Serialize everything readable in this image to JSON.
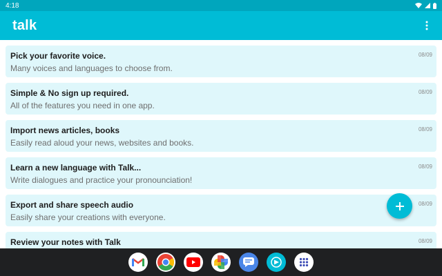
{
  "status_bar": {
    "time": "4:18"
  },
  "app_bar": {
    "title": "talk"
  },
  "notes": [
    {
      "title": "Pick your favorite voice.",
      "subtitle": "Many voices and languages to choose from.",
      "date": "08/09"
    },
    {
      "title": "Simple & No sign up required.",
      "subtitle": "All of the features you need in one app.",
      "date": "08/09"
    },
    {
      "title": "Import news articles, books",
      "subtitle": "Easily read aloud your news, websites and books.",
      "date": "08/09"
    },
    {
      "title": "Learn a new language with Talk...",
      "subtitle": "Write dialogues and practice your pronounciation!",
      "date": "08/09"
    },
    {
      "title": "Export and share speech audio",
      "subtitle": "Easily share your creations with everyone.",
      "date": "08/09"
    },
    {
      "title": "Review your notes with Talk",
      "subtitle": "",
      "date": "08/09"
    }
  ],
  "fab": {
    "icon": "plus-icon"
  },
  "taskbar": {
    "apps": [
      "gmail-icon",
      "chrome-icon",
      "youtube-icon",
      "photos-icon",
      "messages-icon",
      "talk-app-icon",
      "app-drawer-icon"
    ]
  },
  "colors": {
    "status_bar": "#00a6bd",
    "app_bar": "#00bcd6",
    "card": "#dff7fb",
    "taskbar": "#1f2022"
  }
}
